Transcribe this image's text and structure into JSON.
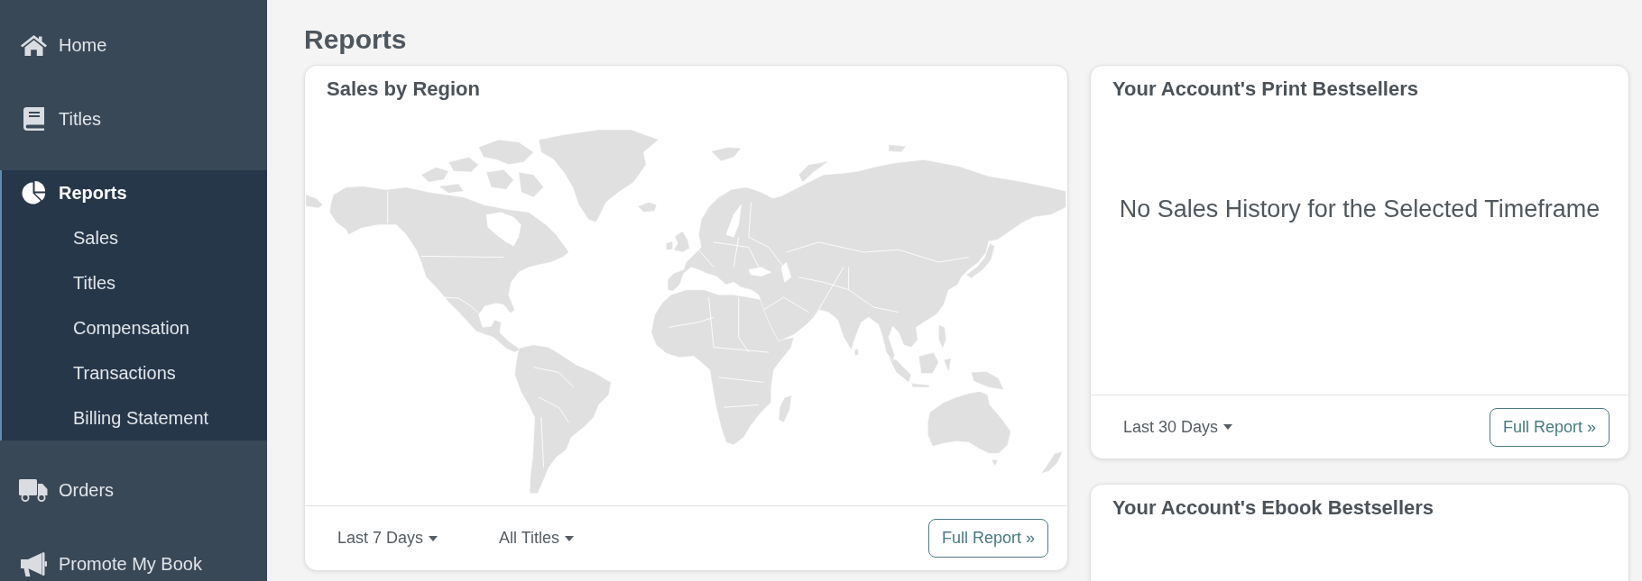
{
  "sidebar": {
    "items": [
      {
        "label": "Home",
        "selected": false
      },
      {
        "label": "Titles",
        "selected": false
      },
      {
        "label": "Reports",
        "selected": true,
        "children": [
          {
            "label": "Sales",
            "selected": false
          },
          {
            "label": "Titles",
            "selected": false
          },
          {
            "label": "Compensation",
            "selected": false
          },
          {
            "label": "Transactions",
            "selected": false
          },
          {
            "label": "Billing Statement",
            "selected": false
          }
        ]
      },
      {
        "label": "Orders",
        "selected": false
      },
      {
        "label": "Promote My Book",
        "selected": false
      }
    ]
  },
  "page_title": "Reports",
  "columns": [
    {
      "cards": [
        {
          "kind": "map",
          "title": "Sales by Region",
          "filters": [
            "Last 7 Days",
            "All Titles"
          ],
          "button": "Full Report »"
        }
      ]
    },
    {
      "cards": [
        {
          "kind": "message",
          "title": "Your Account's Print Bestsellers",
          "message": "No Sales History for the Selected Timeframe",
          "filters": [
            "Last 30 Days"
          ],
          "button": "Full Report »"
        },
        {
          "kind": "empty",
          "title": "Your Account's Ebook Bestsellers"
        }
      ]
    }
  ]
}
